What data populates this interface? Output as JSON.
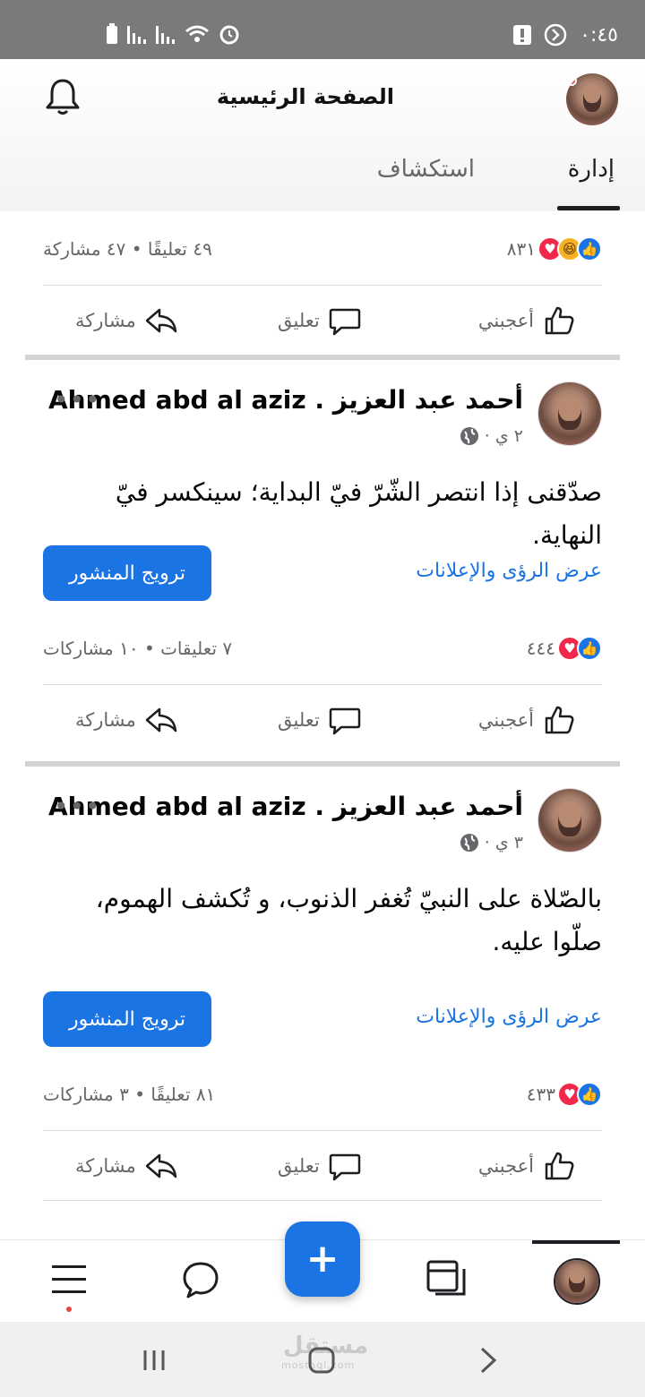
{
  "status_bar": {
    "time": "٠:٤٥"
  },
  "header": {
    "title": "الصفحة الرئيسية",
    "tabs": [
      {
        "label": "إدارة",
        "active": true
      },
      {
        "label": "استكشاف",
        "active": false
      }
    ]
  },
  "posts": [
    {
      "reaction_count": "٨٣١",
      "reactions": [
        "like-icon",
        "haha-icon",
        "love-icon"
      ],
      "counts_text": "٤٩ تعليقًا • ٤٧ مشاركة",
      "actions": {
        "like": "أعجبني",
        "comment": "تعليق",
        "share": "مشاركة"
      }
    },
    {
      "author": "أحمد عبد العزيز . Ahmed abd al aziz",
      "time": "٢ ي ·",
      "text": "صدّقنى إذا انتصر الشّرّ فيّ البداية؛ سينكسر فيّ النهاية.",
      "promote_label": "ترويج المنشور",
      "insights_label": "عرض الرؤى والإعلانات",
      "reaction_count": "٤٤٤",
      "counts_text": "٧ تعليقات • ١٠ مشاركات",
      "actions": {
        "like": "أعجبني",
        "comment": "تعليق",
        "share": "مشاركة"
      }
    },
    {
      "author": "أحمد عبد العزيز . Ahmed abd al aziz",
      "time": "٣ ي ·",
      "text": "بالصّلاة على النبيّ تُغفر الذنوب، و تُكشف الهموم، صلّوا عليه.",
      "promote_label": "ترويج المنشور",
      "insights_label": "عرض الرؤى والإعلانات",
      "reaction_count": "٤٣٣",
      "counts_text": "٨١ تعليقًا • ٣ مشاركات",
      "actions": {
        "like": "أعجبني",
        "comment": "تعليق",
        "share": "مشاركة"
      }
    }
  ],
  "fab_label": "+",
  "watermark": {
    "text": "مستقل",
    "sub": "mostaql.com"
  },
  "colors": {
    "accent": "#1b74e4",
    "like": "#1b74e4",
    "love": "#f02849",
    "haha": "#f7b125",
    "notification_dot": "#e4493a"
  }
}
